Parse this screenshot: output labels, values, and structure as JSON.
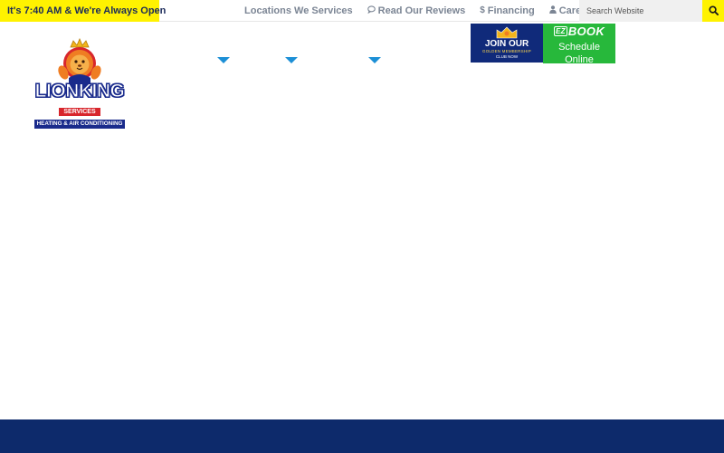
{
  "topbar": {
    "open_hours": "It's 7:40 AM & We're Always Open",
    "links": [
      {
        "label": "Locations We Services",
        "icon": ""
      },
      {
        "label": "Read Our Reviews",
        "icon": "speech-bubble-icon"
      },
      {
        "label": "Financing",
        "icon": "dollar-icon"
      },
      {
        "label": "Careers",
        "icon": "user-icon"
      }
    ],
    "search": {
      "placeholder": "Search Website",
      "value": ""
    }
  },
  "logo": {
    "name": "LIONKING",
    "services": "SERVICES",
    "tagline": "HEATING & AIR CONDITIONING"
  },
  "promos": {
    "club": {
      "title": "JOIN OUR",
      "subtitle": "GOLDEN MEMBERSHIP",
      "cta": "CLUB NOW"
    },
    "book": {
      "logo_prefix": "EZ",
      "logo_main": "BOOK",
      "label": "Schedule Online"
    }
  },
  "colors": {
    "accent_yellow": "#fff200",
    "nav_caret_blue": "#1c8fd6",
    "club_navy": "#102a7a",
    "book_green": "#27b83b",
    "footer_navy": "#0d2a6b",
    "util_link_gray": "#7b8594"
  }
}
